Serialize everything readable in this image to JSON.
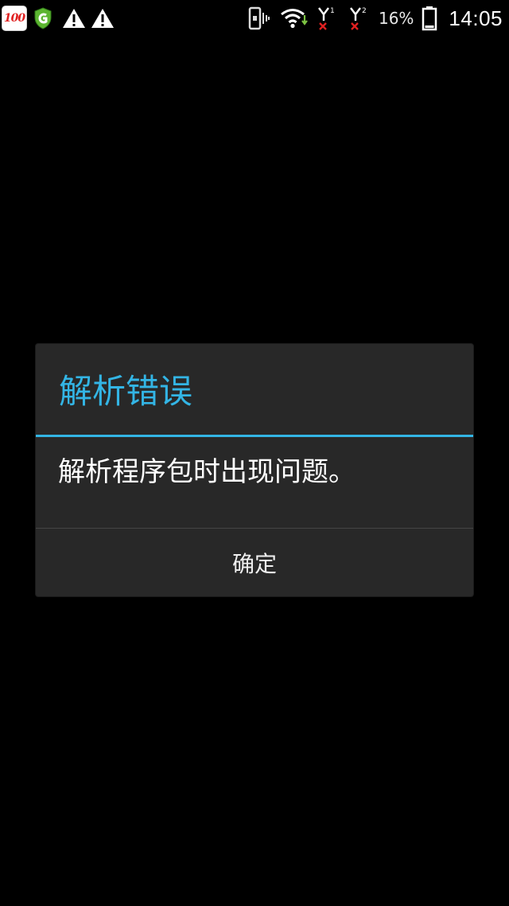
{
  "status_bar": {
    "app_badge_text": "100",
    "battery_percent": "16%",
    "time": "14:05",
    "icons": [
      "app-100-icon",
      "green-shield-app-icon",
      "warning-icon",
      "warning-icon",
      "vibrate-icon",
      "wifi-icon",
      "signal-sim1-icon",
      "signal-sim2-icon",
      "battery-icon"
    ],
    "colors": {
      "wifi_arrow": "#7cc242",
      "no_signal_x": "#e02020"
    }
  },
  "dialog": {
    "title": "解析错误",
    "message": "解析程序包时出现问题。",
    "ok_button_label": "确定",
    "colors": {
      "accent": "#33b5e5",
      "background": "#282828",
      "text": "#ffffff"
    }
  }
}
